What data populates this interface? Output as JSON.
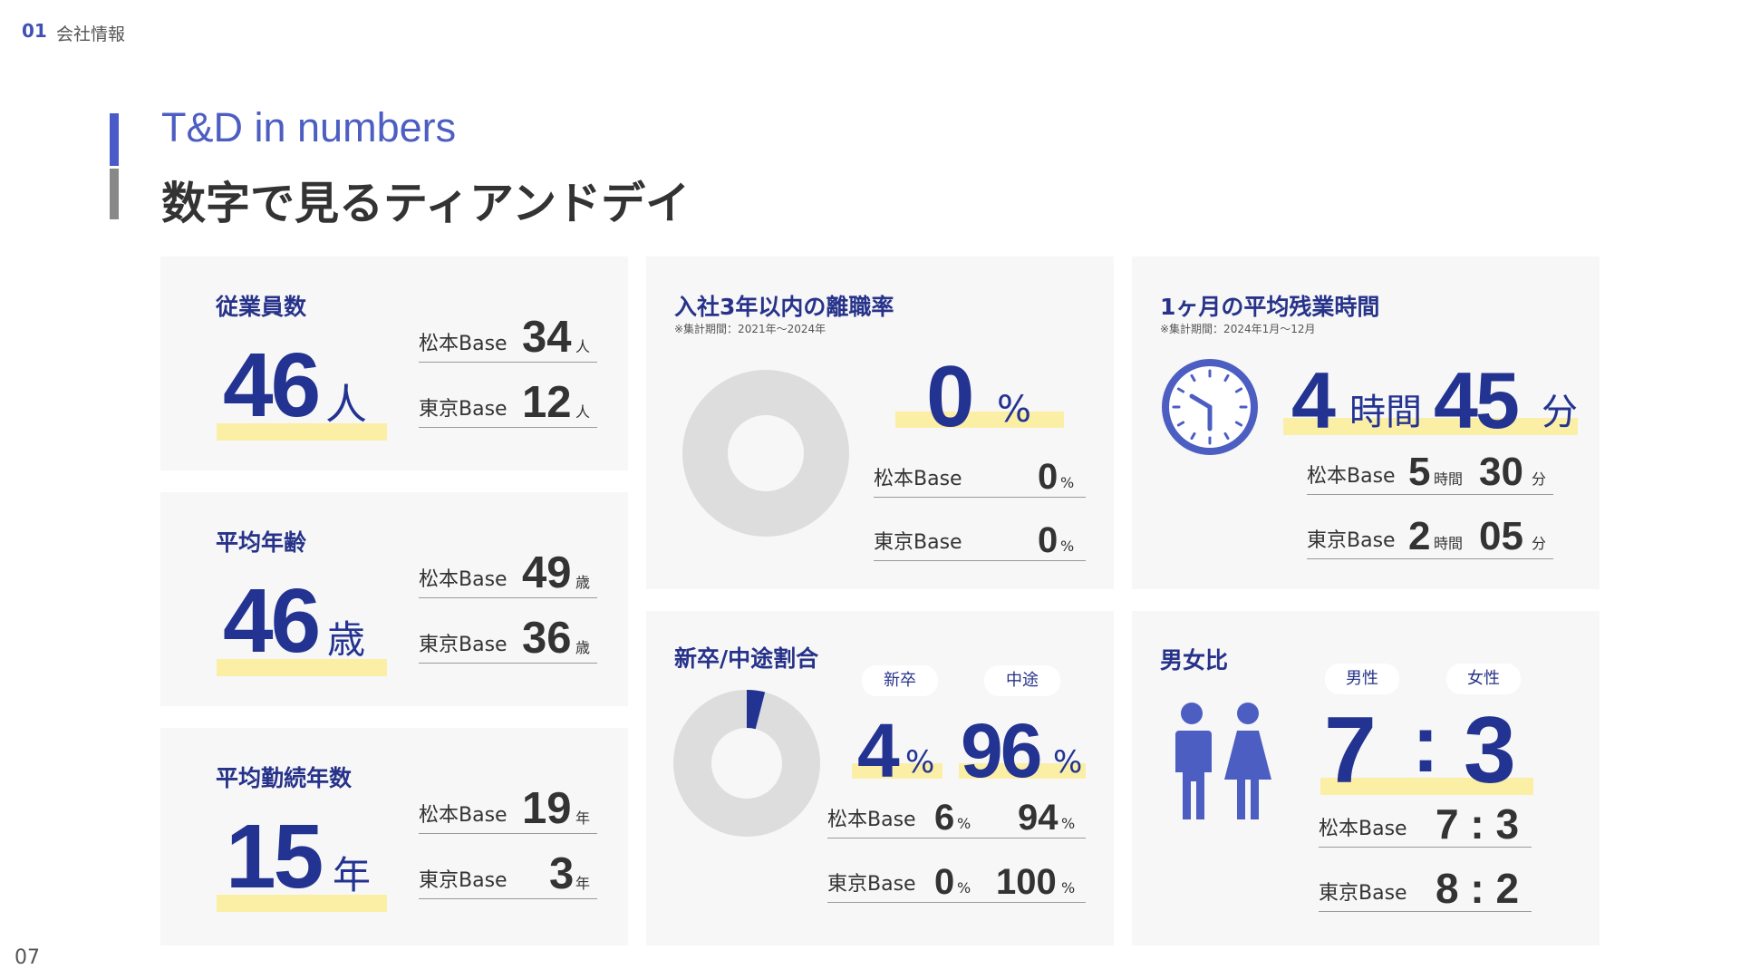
{
  "header": {
    "section_number": "01",
    "section_title": "会社情報"
  },
  "page_number": "07",
  "title": {
    "en": "T&D in numbers",
    "ja": "数字で見るティアンドデイ"
  },
  "colors": {
    "accent": "#233391",
    "title_accent": "#4d5ec2",
    "highlight": "#fbefa6",
    "card_bg": "#f7f7f7",
    "donut_gray": "#dddddd"
  },
  "employees": {
    "title": "従業員数",
    "value": "46",
    "unit": "人",
    "matsumoto": {
      "label": "松本Base",
      "value": "34",
      "unit": "人"
    },
    "tokyo": {
      "label": "東京Base",
      "value": "12",
      "unit": "人"
    }
  },
  "avg_age": {
    "title": "平均年齢",
    "value": "46",
    "unit": "歳",
    "matsumoto": {
      "label": "松本Base",
      "value": "49",
      "unit": "歳"
    },
    "tokyo": {
      "label": "東京Base",
      "value": "36",
      "unit": "歳"
    }
  },
  "avg_tenure": {
    "title": "平均勤続年数",
    "value": "15",
    "unit": "年",
    "matsumoto": {
      "label": "松本Base",
      "value": "19",
      "unit": "年"
    },
    "tokyo": {
      "label": "東京Base",
      "value": "3",
      "unit": "年"
    }
  },
  "turnover": {
    "title": "入社3年以内の離職率",
    "note": "※集計期間：2021年～2024年",
    "value": "0",
    "unit": "%",
    "matsumoto": {
      "label": "松本Base",
      "value": "0",
      "unit": "%"
    },
    "tokyo": {
      "label": "東京Base",
      "value": "0",
      "unit": "%"
    }
  },
  "overtime": {
    "title": "1ヶ月の平均残業時間",
    "note": "※集計期間：2024年1月～12月",
    "hours": "4",
    "hours_unit": "時間",
    "minutes": "45",
    "minutes_unit": "分",
    "matsumoto": {
      "label": "松本Base",
      "hours": "5",
      "hours_unit": "時間",
      "minutes": "30",
      "minutes_unit": "分"
    },
    "tokyo": {
      "label": "東京Base",
      "hours": "2",
      "hours_unit": "時間",
      "minutes": "05",
      "minutes_unit": "分"
    },
    "icon": "clock-icon"
  },
  "hire_ratio": {
    "title": "新卒/中途割合",
    "new_grad": {
      "label": "新卒",
      "value": "4",
      "unit": "%"
    },
    "mid_career": {
      "label": "中途",
      "value": "96",
      "unit": "%"
    },
    "matsumoto": {
      "label": "松本Base",
      "new": "6",
      "mid": "94",
      "unit": "%"
    },
    "tokyo": {
      "label": "東京Base",
      "new": "0",
      "mid": "100",
      "unit": "%"
    }
  },
  "gender": {
    "title": "男女比",
    "male_label": "男性",
    "female_label": "女性",
    "male": "7",
    "female": "3",
    "sep": ":",
    "matsumoto": {
      "label": "松本Base",
      "ratio": "7 : 3"
    },
    "tokyo": {
      "label": "東京Base",
      "ratio": "8 : 2"
    },
    "icon": "male-female-icon"
  },
  "chart_data": [
    {
      "type": "pie",
      "categories": [
        "離職"
      ],
      "values": [
        0
      ]
    },
    {
      "type": "pie",
      "categories": [
        "新卒",
        "中途"
      ],
      "values": [
        4,
        96
      ]
    }
  ]
}
